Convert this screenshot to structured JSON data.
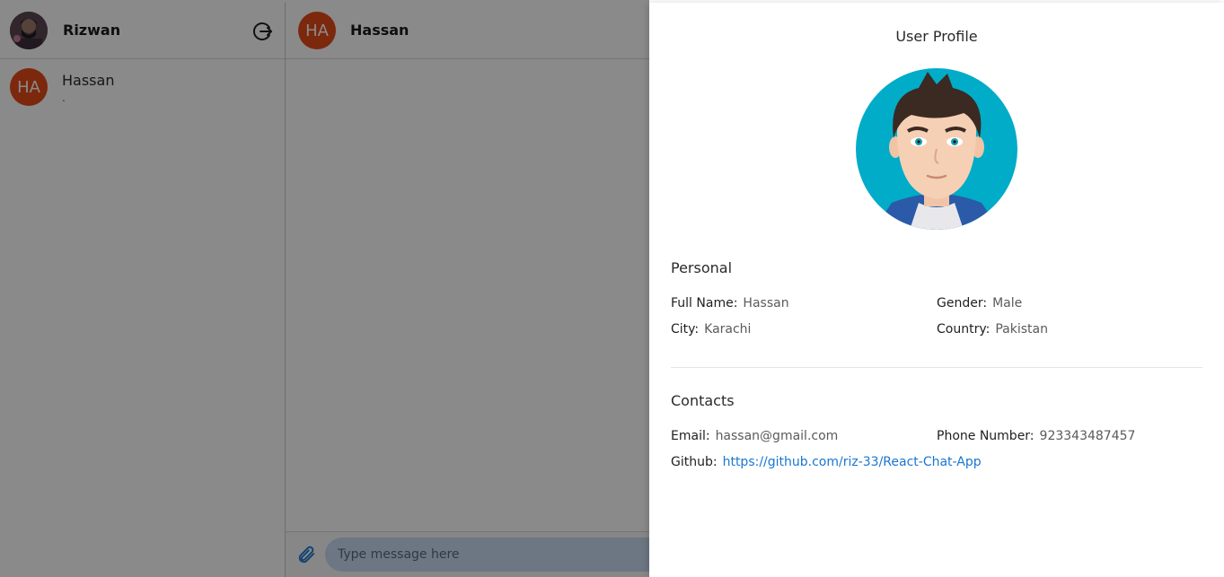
{
  "sidebar": {
    "user_name": "Rizwan",
    "contacts": [
      {
        "initials": "HA",
        "name": "Hassan",
        "preview": "."
      }
    ]
  },
  "chat": {
    "contact_initials": "HA",
    "contact_name": "Hassan",
    "input_placeholder": "Type message here"
  },
  "profile": {
    "title": "User Profile",
    "personal": {
      "heading": "Personal",
      "full_name_label": "Full Name:",
      "full_name": "Hassan",
      "gender_label": "Gender:",
      "gender": "Male",
      "city_label": "City:",
      "city": "Karachi",
      "country_label": "Country:",
      "country": "Pakistan"
    },
    "contacts": {
      "heading": "Contacts",
      "email_label": "Email:",
      "email": "hassan@gmail.com",
      "phone_label": "Phone Number:",
      "phone": "923343487457",
      "github_label": "Github:",
      "github": "https://github.com/riz-33/React-Chat-App"
    }
  },
  "colors": {
    "initials_avatar_bg": "#e64a19",
    "input_bg": "#c8ddf2",
    "link": "#1976d2",
    "profile_avatar_bg": "#00acc8"
  },
  "icons": {
    "logout": "logout-icon",
    "attach": "paperclip-icon"
  }
}
